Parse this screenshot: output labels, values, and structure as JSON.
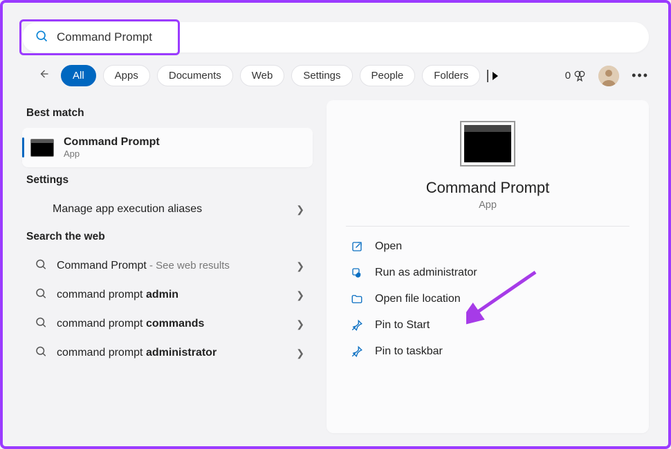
{
  "search": {
    "query": "Command Prompt"
  },
  "filters": {
    "items": [
      "All",
      "Apps",
      "Documents",
      "Web",
      "Settings",
      "People",
      "Folders"
    ],
    "active_index": 0
  },
  "rewards": {
    "points": "0"
  },
  "left_panel": {
    "best_match_header": "Best match",
    "best_match": {
      "title": "Command Prompt",
      "subtitle": "App"
    },
    "settings_header": "Settings",
    "settings_item": "Manage app execution aliases",
    "web_header": "Search the web",
    "web_items": [
      {
        "prefix": "Command Prompt",
        "suffix": "See web results"
      },
      {
        "prefix": "command prompt ",
        "bold": "admin"
      },
      {
        "prefix": "command prompt ",
        "bold": "commands"
      },
      {
        "prefix": "command prompt ",
        "bold": "administrator"
      }
    ]
  },
  "detail": {
    "title": "Command Prompt",
    "subtitle": "App",
    "actions": [
      {
        "icon": "open-icon",
        "label": "Open"
      },
      {
        "icon": "shield-icon",
        "label": "Run as administrator"
      },
      {
        "icon": "folder-icon",
        "label": "Open file location"
      },
      {
        "icon": "pin-icon",
        "label": "Pin to Start"
      },
      {
        "icon": "pin-icon",
        "label": "Pin to taskbar"
      }
    ]
  },
  "misc": {
    "web_suffix_sep": " - "
  }
}
